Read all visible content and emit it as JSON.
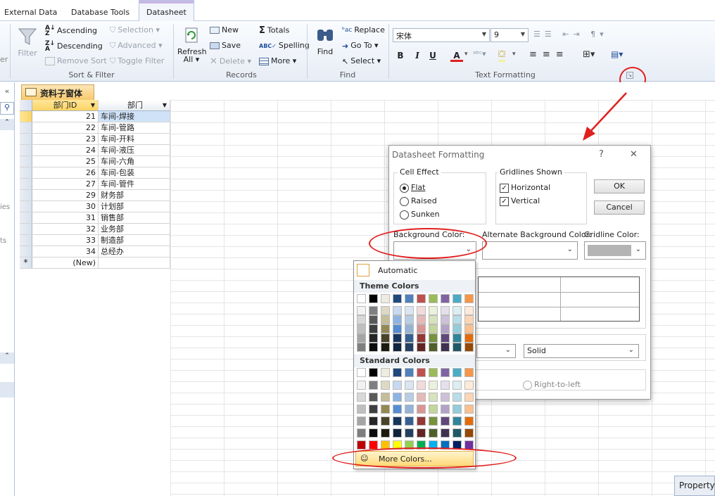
{
  "tabs": [
    {
      "label": "External Data"
    },
    {
      "label": "Database Tools"
    },
    {
      "label": "Datasheet",
      "active": true
    }
  ],
  "ribbon": {
    "partial_left": {
      "filter_frag": "er",
      "label_frag": "ies",
      "label_frag2": "ts"
    },
    "sort_filter": {
      "label": "Sort & Filter",
      "filter": "Filter",
      "ascending": "Ascending",
      "descending": "Descending",
      "remove_sort": "Remove Sort",
      "selection": "Selection",
      "advanced": "Advanced",
      "toggle_filter": "Toggle Filter"
    },
    "records": {
      "label": "Records",
      "refresh": "Refresh",
      "refresh2": "All",
      "new": "New",
      "save": "Save",
      "delete": "Delete",
      "totals": "Totals",
      "spelling": "Spelling",
      "more": "More"
    },
    "find": {
      "label": "Find",
      "find": "Find",
      "replace": "Replace",
      "goto": "Go To",
      "select": "Select"
    },
    "text_formatting": {
      "label": "Text Formatting",
      "font": "宋体",
      "size": "9",
      "bold": "B",
      "italic": "I",
      "underline": "U",
      "fontcolor_letter": "A"
    }
  },
  "doc_tab": {
    "label": "资料子窗体"
  },
  "table": {
    "headers": [
      "部门ID",
      "部门"
    ],
    "rows": [
      {
        "id": "21",
        "name": "车间-焊接"
      },
      {
        "id": "22",
        "name": "车间-管路"
      },
      {
        "id": "23",
        "name": "车间-开料"
      },
      {
        "id": "24",
        "name": "车间-液压"
      },
      {
        "id": "25",
        "name": "车间-六角"
      },
      {
        "id": "26",
        "name": "车间-包装"
      },
      {
        "id": "27",
        "name": "车间-管件"
      },
      {
        "id": "29",
        "name": "财务部"
      },
      {
        "id": "30",
        "name": "计划部"
      },
      {
        "id": "31",
        "name": "销售部"
      },
      {
        "id": "32",
        "name": "业务部"
      },
      {
        "id": "33",
        "name": "制造部"
      },
      {
        "id": "34",
        "name": "总经办"
      }
    ],
    "new_row_marker": "*",
    "new_row_label": "(New)"
  },
  "dialog": {
    "title": "Datasheet Formatting",
    "help": "?",
    "close": "✕",
    "cell_effect": {
      "title": "Cell Effect",
      "flat": "Flat",
      "raised": "Raised",
      "sunken": "Sunken"
    },
    "gridlines": {
      "title": "Gridlines Shown",
      "horizontal": "Horizontal",
      "vertical": "Vertical"
    },
    "ok": "OK",
    "cancel": "Cancel",
    "bg_color_label": "Background Color:",
    "alt_bg_color_label": "Alternate Background Color:",
    "gridline_color_label": "Gridline Color:",
    "border_style": "Solid",
    "rtl": "Right-to-left"
  },
  "palette": {
    "automatic": "Automatic",
    "theme_title": "Theme Colors",
    "standard_title": "Standard Colors",
    "more_colors": "More Colors...",
    "theme_top": [
      "#ffffff",
      "#000000",
      "#eeece1",
      "#1f497d",
      "#4f81bd",
      "#c0504d",
      "#9bbb59",
      "#8064a2",
      "#4bacc6",
      "#f79646"
    ],
    "theme_shades": [
      [
        "#f2f2f2",
        "#7f7f7f",
        "#ddd9c3",
        "#c6d9f0",
        "#dbe5f1",
        "#f2dcdb",
        "#ebf1dd",
        "#e5e0ec",
        "#dbeef3",
        "#fdeada"
      ],
      [
        "#d8d8d8",
        "#595959",
        "#c4bd97",
        "#8db3e2",
        "#b8cce4",
        "#e5b9b7",
        "#d7e3bc",
        "#ccc1d9",
        "#b7dde8",
        "#fbd5b5"
      ],
      [
        "#bfbfbf",
        "#3f3f3f",
        "#938953",
        "#548dd4",
        "#95b3d7",
        "#d99694",
        "#c3d69b",
        "#b2a2c7",
        "#92cddc",
        "#fac08f"
      ],
      [
        "#a5a5a5",
        "#262626",
        "#494429",
        "#17365d",
        "#366092",
        "#953734",
        "#76923c",
        "#5f497a",
        "#31859b",
        "#e36c09"
      ],
      [
        "#7f7f7f",
        "#0c0c0c",
        "#1d1b10",
        "#0f243e",
        "#244061",
        "#632423",
        "#4f6128",
        "#3f3151",
        "#205867",
        "#974806"
      ]
    ],
    "standard_top": [
      "#ffffff",
      "#000000",
      "#eeece1",
      "#1f497d",
      "#4f81bd",
      "#c0504d",
      "#9bbb59",
      "#8064a2",
      "#4bacc6",
      "#f79646"
    ],
    "standard_rows": [
      [
        "#f2f2f2",
        "#7f7f7f",
        "#ddd9c3",
        "#c6d9f0",
        "#dbe5f1",
        "#f2dcdb",
        "#ebf1dd",
        "#e5e0ec",
        "#dbeef3",
        "#fdeada"
      ],
      [
        "#d8d8d8",
        "#595959",
        "#c4bd97",
        "#8db3e2",
        "#b8cce4",
        "#e5b9b7",
        "#d7e3bc",
        "#ccc1d9",
        "#b7dde8",
        "#fbd5b5"
      ],
      [
        "#bfbfbf",
        "#3f3f3f",
        "#938953",
        "#548dd4",
        "#95b3d7",
        "#d99694",
        "#c3d69b",
        "#b2a2c7",
        "#92cddc",
        "#fac08f"
      ],
      [
        "#a5a5a5",
        "#262626",
        "#494429",
        "#17365d",
        "#366092",
        "#953734",
        "#76923c",
        "#5f497a",
        "#31859b",
        "#e36c09"
      ],
      [
        "#7f7f7f",
        "#0c0c0c",
        "#1d1b10",
        "#0f243e",
        "#244061",
        "#632423",
        "#4f6128",
        "#3f3151",
        "#205867",
        "#974806"
      ],
      [
        "#c00000",
        "#ff0000",
        "#ffc000",
        "#ffff00",
        "#92d050",
        "#00b050",
        "#00b0f0",
        "#0070c0",
        "#002060",
        "#7030a0"
      ]
    ]
  },
  "status": {
    "property_sheet": "Property"
  },
  "colors": {
    "accent": "#e0201f",
    "tab_orange": "#f8c96c",
    "ribbon_bg": "#e7edf6"
  }
}
